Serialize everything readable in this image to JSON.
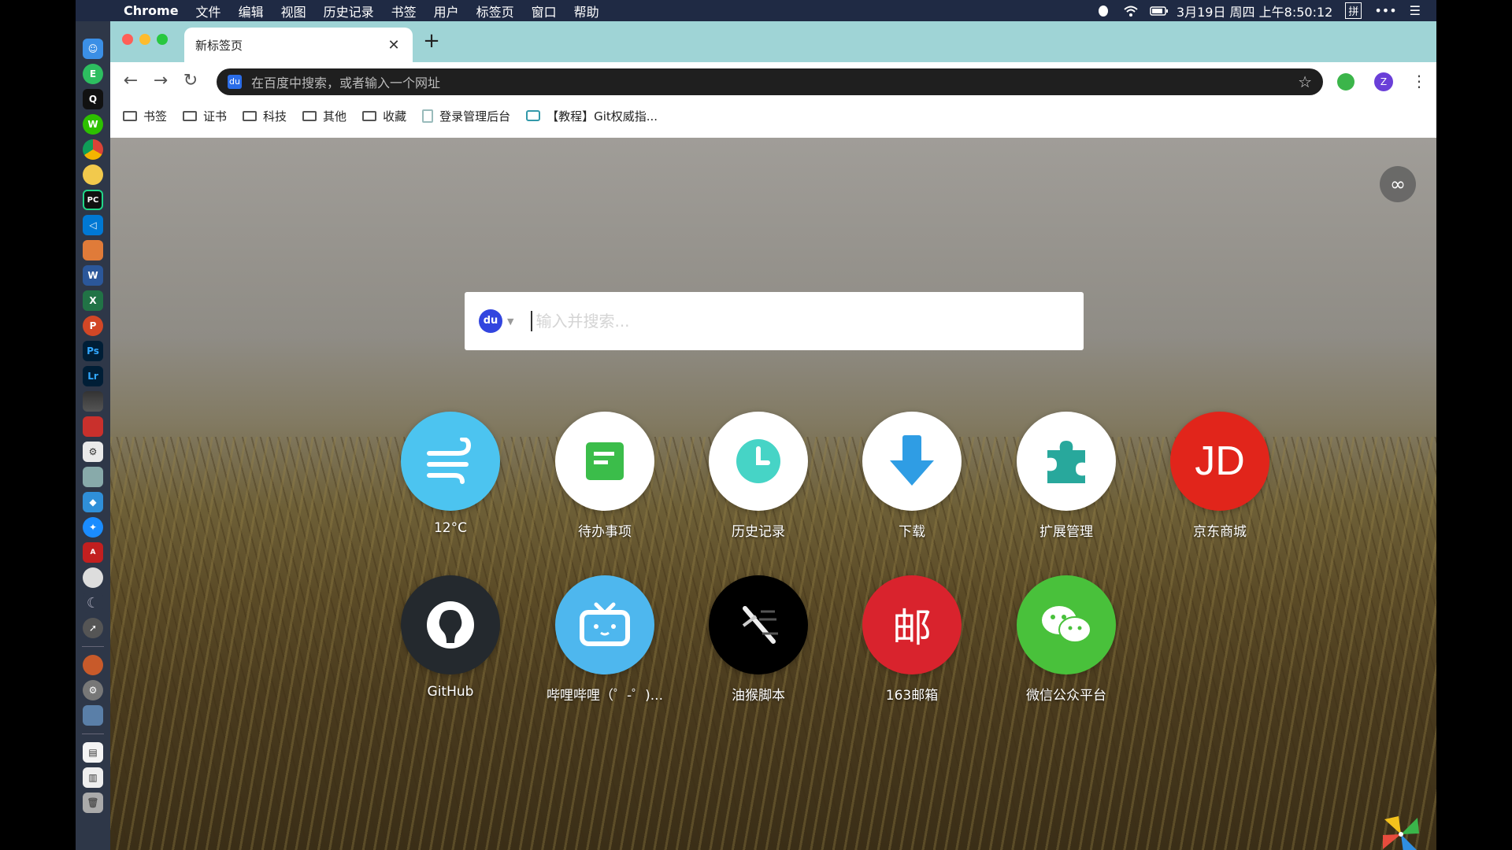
{
  "menubar": {
    "app_name": "Chrome",
    "items": [
      "文件",
      "编辑",
      "视图",
      "历史记录",
      "书签",
      "用户",
      "标签页",
      "窗口",
      "帮助"
    ],
    "datetime": "3月19日 周四 上午8:50:12",
    "input_method": "拼"
  },
  "dock": {
    "icons": [
      "finder-icon",
      "evernote-icon",
      "qq-icon",
      "wechat-icon",
      "chrome-icon",
      "idea-icon",
      "pycharm-icon",
      "vscode-icon",
      "app-icon",
      "word-icon",
      "excel-icon",
      "powerpoint-icon",
      "photoshop-icon",
      "lightroom-icon",
      "finalcut-icon",
      "parallels-icon",
      "app-icon",
      "preview-icon",
      "app-icon",
      "safari-icon",
      "acrobat-icon",
      "app-icon",
      "moon-icon",
      "launchpad-icon",
      "app-icon",
      "system-preferences-icon",
      "app-icon",
      "document-icon",
      "app-icon",
      "trash-icon"
    ]
  },
  "browser": {
    "tab": {
      "title": "新标签页"
    },
    "omnibox": {
      "placeholder": "在百度中搜索，或者输入一个网址"
    },
    "avatar_letter": "Z",
    "bookmarks": [
      {
        "label": "书签",
        "type": "folder"
      },
      {
        "label": "证书",
        "type": "folder"
      },
      {
        "label": "科技",
        "type": "folder"
      },
      {
        "label": "其他",
        "type": "folder"
      },
      {
        "label": "收藏",
        "type": "folder"
      },
      {
        "label": "登录管理后台",
        "type": "page"
      },
      {
        "label": "【教程】Git权威指...",
        "type": "page"
      }
    ]
  },
  "newtab": {
    "search": {
      "placeholder": "输入并搜索..."
    },
    "engine_icon": "baidu-icon",
    "infinity_icon": "∞",
    "tiles": [
      {
        "label": "12°C",
        "icon": "wind-icon",
        "color": "#4cc4f0"
      },
      {
        "label": "待办事项",
        "icon": "note-icon",
        "color": "#ffffff"
      },
      {
        "label": "历史记录",
        "icon": "clock-icon",
        "color": "#ffffff"
      },
      {
        "label": "下载",
        "icon": "download-arrow-icon",
        "color": "#ffffff"
      },
      {
        "label": "扩展管理",
        "icon": "puzzle-icon",
        "color": "#ffffff"
      },
      {
        "label": "京东商城",
        "icon": "jd-icon",
        "color": "#e1251b"
      },
      {
        "label": "GitHub",
        "icon": "github-icon",
        "color": "#24292e"
      },
      {
        "label": "哔哩哔哩（゜-゜)...",
        "icon": "bilibili-tv-icon",
        "color": "#4eb7ee"
      },
      {
        "label": "油猴脚本",
        "icon": "tampermonkey-icon",
        "color": "#000000"
      },
      {
        "label": "163邮箱",
        "icon": "mail-icon",
        "color": "#d9232d"
      },
      {
        "label": "微信公众平台",
        "icon": "wechat-bubbles-icon",
        "color": "#49c13b"
      }
    ]
  }
}
